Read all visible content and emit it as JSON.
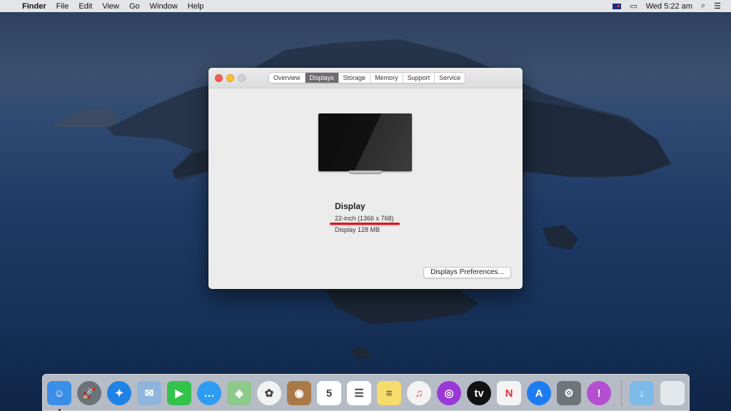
{
  "menubar": {
    "app": "Finder",
    "items": [
      "File",
      "Edit",
      "View",
      "Go",
      "Window",
      "Help"
    ],
    "clock": "Wed 5:22 am"
  },
  "window": {
    "tabs": [
      {
        "label": "Overview",
        "active": false
      },
      {
        "label": "Displays",
        "active": true
      },
      {
        "label": "Storage",
        "active": false
      },
      {
        "label": "Memory",
        "active": false
      },
      {
        "label": "Support",
        "active": false
      },
      {
        "label": "Service",
        "active": false
      }
    ],
    "display": {
      "title": "Display",
      "size": "22-inch (1366 x 768)",
      "memory": "Display 128 MB"
    },
    "prefs_button": "Displays Preferences...",
    "highlight_color": "#e0141b"
  },
  "dock": {
    "items": [
      {
        "name": "finder",
        "color": "#3a8ee8",
        "glyph": "☺",
        "running": true
      },
      {
        "name": "launchpad",
        "color": "#6c7278",
        "glyph": "🚀"
      },
      {
        "name": "safari",
        "color": "#1f83e6",
        "glyph": "✦"
      },
      {
        "name": "mail",
        "color": "#8fb5dc",
        "glyph": "✉"
      },
      {
        "name": "facetime",
        "color": "#33c34a",
        "glyph": "▶"
      },
      {
        "name": "messages",
        "color": "#2f9cf3",
        "glyph": "…"
      },
      {
        "name": "maps",
        "color": "#8dc98a",
        "glyph": "◈"
      },
      {
        "name": "photos",
        "color": "#f2f2f2",
        "glyph": "✿"
      },
      {
        "name": "contacts",
        "color": "#a97a48",
        "glyph": "◉"
      },
      {
        "name": "calendar",
        "color": "#ffffff",
        "glyph": "5"
      },
      {
        "name": "reminders",
        "color": "#ffffff",
        "glyph": "☰"
      },
      {
        "name": "notes",
        "color": "#f7dc6b",
        "glyph": "≡"
      },
      {
        "name": "music",
        "color": "#f3f3f3",
        "glyph": "♫"
      },
      {
        "name": "podcasts",
        "color": "#9b38d8",
        "glyph": "◎"
      },
      {
        "name": "tv",
        "color": "#111111",
        "glyph": "tv"
      },
      {
        "name": "news",
        "color": "#f4f4f4",
        "glyph": "N"
      },
      {
        "name": "app-store",
        "color": "#1d7cf2",
        "glyph": "A"
      },
      {
        "name": "system-preferences",
        "color": "#6f7478",
        "glyph": "⚙"
      },
      {
        "name": "feedback-assistant",
        "color": "#b44fd0",
        "glyph": "!"
      },
      {
        "name": "downloads-folder",
        "color": "#7dbbe8",
        "glyph": "↓"
      },
      {
        "name": "trash",
        "color": "#e4e8ec",
        "glyph": ""
      }
    ]
  }
}
